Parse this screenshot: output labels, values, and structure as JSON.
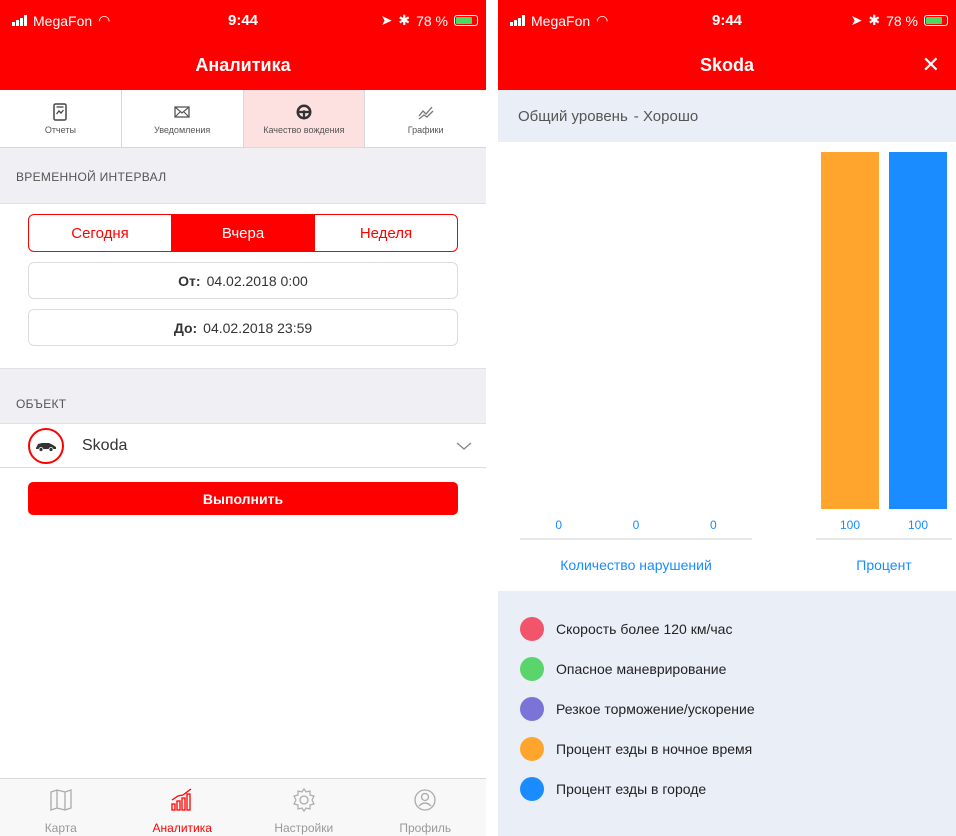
{
  "left": {
    "status": {
      "carrier": "MegaFon",
      "time": "9:44",
      "battery": "78 %"
    },
    "title": "Аналитика",
    "top_tabs": [
      {
        "label": "Отчеты",
        "icon": "report-icon"
      },
      {
        "label": "Уведомления",
        "icon": "envelope-icon"
      },
      {
        "label": "Качество вождения",
        "icon": "steering-wheel-icon",
        "active": true
      },
      {
        "label": "Графики",
        "icon": "graph-icon"
      }
    ],
    "interval_title": "ВРЕМЕННОЙ ИНТЕРВАЛ",
    "segments": [
      {
        "label": "Сегодня"
      },
      {
        "label": "Вчера",
        "active": true
      },
      {
        "label": "Неделя"
      }
    ],
    "from_label": "От:",
    "from_value": "04.02.2018 0:00",
    "to_label": "До:",
    "to_value": "04.02.2018 23:59",
    "object_title": "ОБЪЕКТ",
    "object_name": "Skoda",
    "run_button": "Выполнить",
    "bottom_tabs": [
      {
        "label": "Карта",
        "icon": "map-icon"
      },
      {
        "label": "Аналитика",
        "icon": "analytics-icon",
        "active": true
      },
      {
        "label": "Настройки",
        "icon": "gear-icon"
      },
      {
        "label": "Профиль",
        "icon": "profile-icon"
      }
    ],
    "accent_color": "#ff0000"
  },
  "right": {
    "status": {
      "carrier": "MegaFon",
      "time": "9:44",
      "battery": "78 %"
    },
    "title": "Skoda",
    "level_label": "Общий уровень",
    "level_value": "- Хорошо",
    "legend": [
      {
        "label": "Скорость более 120 км/час",
        "color": "#f2546b"
      },
      {
        "label": "Опасное маневрирование",
        "color": "#5ad56c"
      },
      {
        "label": "Резкое торможение/ускорение",
        "color": "#7a74d8"
      },
      {
        "label": "Процент езды в ночное время",
        "color": "#ffa52e"
      },
      {
        "label": "Процент езды в городе",
        "color": "#1a8cff"
      }
    ]
  },
  "chart_data": [
    {
      "type": "bar",
      "xlabel": "Количество нарушений",
      "categories": [
        "Скорость более 120 км/час",
        "Опасное маневрирование",
        "Резкое торможение/ускорение"
      ],
      "values": [
        0,
        0,
        0
      ],
      "colors": [
        "#f2546b",
        "#5ad56c",
        "#7a74d8"
      ],
      "ylim": [
        0,
        100
      ]
    },
    {
      "type": "bar",
      "xlabel": "Процент",
      "categories": [
        "Процент езды в ночное время",
        "Процент езды в городе"
      ],
      "values": [
        100,
        100
      ],
      "colors": [
        "#ffa52e",
        "#1a8cff"
      ],
      "ylim": [
        0,
        100
      ]
    }
  ]
}
